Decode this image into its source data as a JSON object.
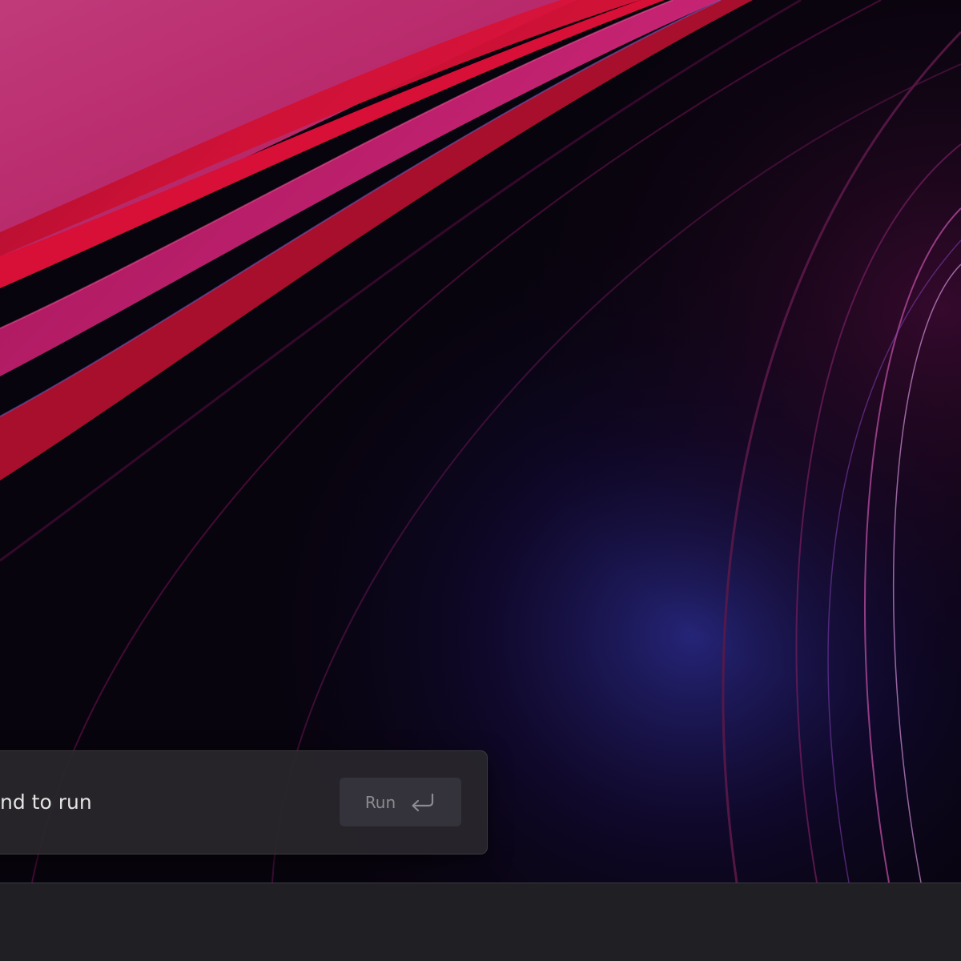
{
  "run_dialog": {
    "command_text": "mmand to run",
    "run_button_label": "Run",
    "run_button_icon": "enter-return-icon"
  },
  "taskbar": {},
  "colors": {
    "panel_background": "#28262c",
    "button_background": "#34323a",
    "button_text": "#8d8b92",
    "taskbar_background": "#202024",
    "wallpaper_red": "#d01040",
    "wallpaper_magenta": "#c02a78",
    "wallpaper_blue": "#2b3ab0"
  }
}
